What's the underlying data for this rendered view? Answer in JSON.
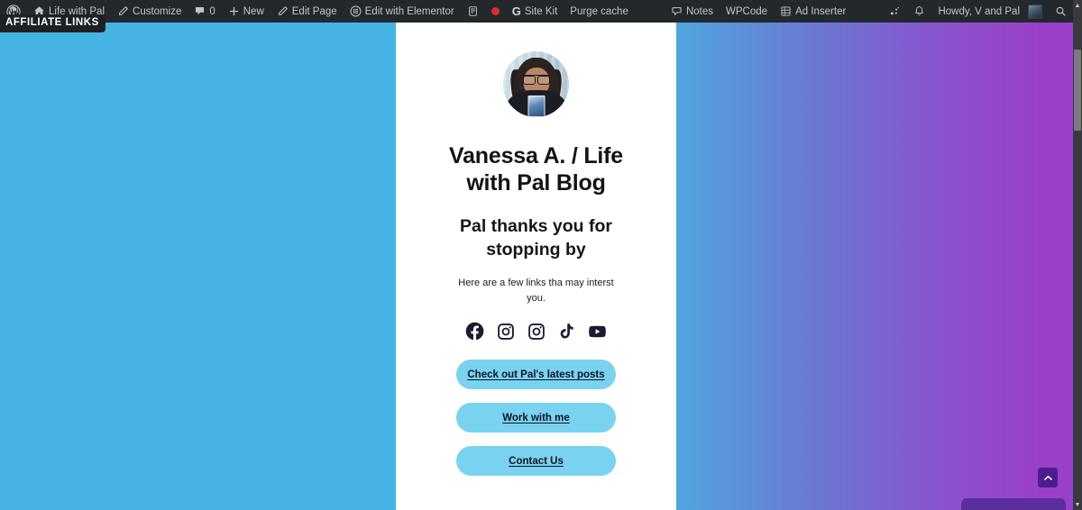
{
  "adminbar": {
    "left_items": [
      {
        "label": "",
        "icon": "wordpress-logo-icon",
        "name": "wp-logo"
      },
      {
        "label": "Life with Pal",
        "icon": "home-icon",
        "name": "site-name"
      },
      {
        "label": "Customize",
        "icon": "pencil-icon",
        "name": "customize"
      },
      {
        "label": "0",
        "icon": "comment-bubble-icon",
        "name": "comments"
      },
      {
        "label": "New",
        "icon": "plus-icon",
        "name": "new-content"
      },
      {
        "label": "Edit Page",
        "icon": "pencil-icon",
        "name": "edit-page"
      },
      {
        "label": "Edit with Elementor",
        "icon": "elementor-icon",
        "name": "edit-with-elementor"
      },
      {
        "label": "",
        "icon": "wpforms-icon",
        "name": "wpforms"
      },
      {
        "label": "",
        "icon": "red-dot-icon",
        "name": "notification-dot"
      },
      {
        "label": "Site Kit",
        "icon": "google-g-icon",
        "name": "site-kit"
      },
      {
        "label": "Purge cache",
        "icon": "none",
        "name": "purge-cache"
      },
      {
        "label": "Notes",
        "icon": "note-icon",
        "name": "notes"
      },
      {
        "label": "WPCode",
        "icon": "none",
        "name": "wpcode"
      },
      {
        "label": "Ad Inserter",
        "icon": "grid-icon",
        "name": "ad-inserter"
      }
    ],
    "right_items": [
      {
        "label": "",
        "icon": "jetpack-stats-icon",
        "name": "jetpack-stats"
      },
      {
        "label": "",
        "icon": "bell-icon",
        "name": "notifications"
      },
      {
        "label": "Howdy, V and Pal",
        "icon": "avatar-icon",
        "name": "my-account"
      },
      {
        "label": "",
        "icon": "search-icon",
        "name": "search"
      }
    ]
  },
  "affiliate_badge": {
    "label": "AFFILIATE LINKS"
  },
  "card": {
    "avatar_alt": "Vanessa A. profile photo",
    "title": "Vanessa A. / Life with Pal Blog",
    "subtitle": "Pal thanks you for stopping by",
    "blurb": "Here are a few links tha may interst you.",
    "socials": [
      {
        "name": "facebook-icon",
        "label": "Facebook"
      },
      {
        "name": "instagram-icon",
        "label": "Instagram"
      },
      {
        "name": "instagram-icon-2",
        "label": "Instagram"
      },
      {
        "name": "tiktok-icon",
        "label": "TikTok"
      },
      {
        "name": "youtube-icon",
        "label": "YouTube"
      }
    ],
    "buttons": [
      {
        "label": "Check out Pal's latest posts"
      },
      {
        "label": "Work with me"
      },
      {
        "label": "Contact Us"
      }
    ]
  },
  "scroll_top": {
    "icon": "chevron-up-icon"
  },
  "colors": {
    "adminbar_bg": "#23282d",
    "card_bg": "#ffffff",
    "button_bg": "#79d2ef",
    "button_text": "#0f1424",
    "gradient_start": "#45b3e3",
    "gradient_end": "#9a3fc9",
    "scroll_top_bg": "#4b1d8f",
    "badge_bg": "#1d2125"
  }
}
